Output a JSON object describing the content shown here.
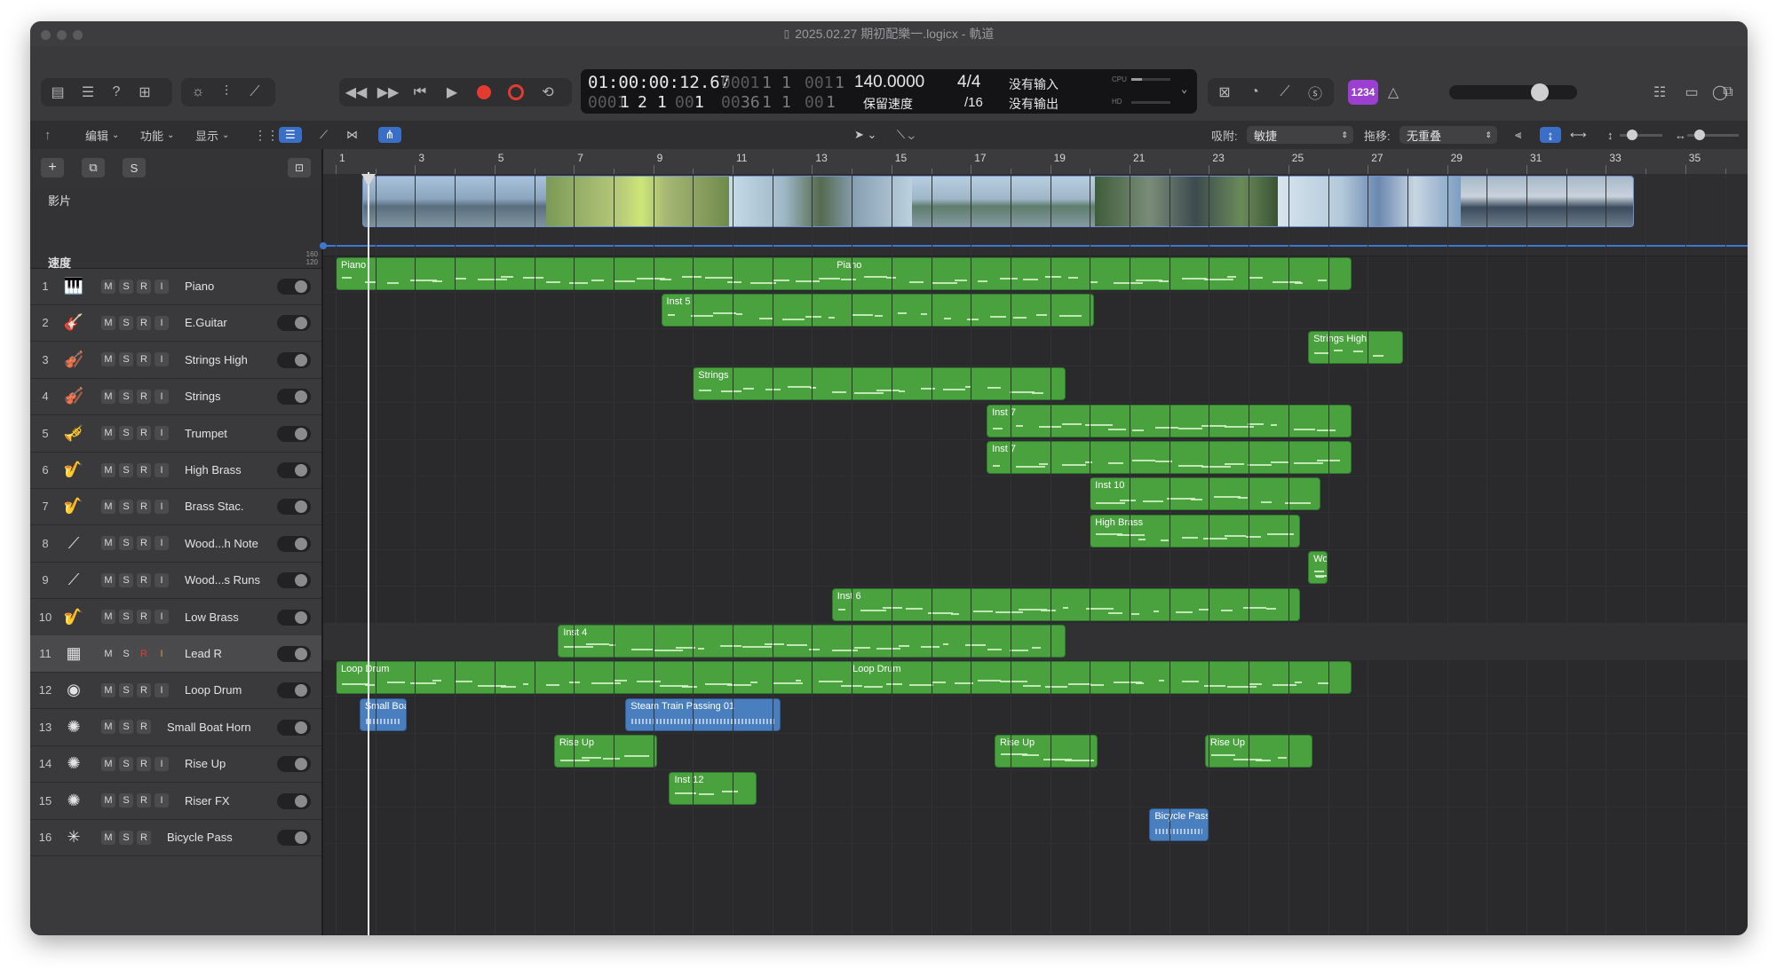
{
  "window": {
    "title": "2025.02.27 期初配樂一.logicx - 軌道"
  },
  "toolbar": {
    "lcd": {
      "smpte": "01:00:00:12.67",
      "pos_bar_dim": "0001",
      "pos_beat": "1",
      "pos_div": "1",
      "pos_tick_dim": "001",
      "pos_tick": "1",
      "line2_bar_dim": "0001",
      "line2_bar": "1",
      "line2_beat": "2",
      "line2_div": "1",
      "line2_tick_dim": "001",
      "line2_tick": "1",
      "line2_bar2_dim": "00",
      "line2_bar2": "36",
      "line2_beat2": "1",
      "line2_div2": "1",
      "line2_tick2_dim": "00",
      "line2_tick2": "1",
      "tempo": "140.0000",
      "tempo_mode": "保留速度",
      "signature": "4/4",
      "division": "/16",
      "input": "没有输入",
      "output": "没有输出",
      "cpu_label": "CPU",
      "hd_label": "HD"
    },
    "key_badge": "1234",
    "colors": {
      "record": "#e23b30",
      "lcd_bg": "#141416",
      "key_badge": "#9b3fd0"
    }
  },
  "subbar": {
    "edit": "编辑",
    "function": "功能",
    "view": "显示",
    "snap_label": "吸附:",
    "snap_value": "敏捷",
    "drag_label": "拖移:",
    "drag_value": "无重叠"
  },
  "header": {
    "movie_label": "影片",
    "tempo_label": "速度",
    "tempo_high": "160",
    "tempo_low": "120",
    "solo": "S"
  },
  "ruler": [
    "1",
    "3",
    "5",
    "7",
    "9",
    "11",
    "13",
    "15",
    "17",
    "19",
    "21",
    "23",
    "25",
    "27",
    "29",
    "31",
    "33",
    "35"
  ],
  "tracks": [
    {
      "num": "1",
      "name": "Piano",
      "icon": "piano-icon",
      "r": true,
      "i": true
    },
    {
      "num": "2",
      "name": "E.Guitar",
      "icon": "guitar-icon",
      "r": true,
      "i": true
    },
    {
      "num": "3",
      "name": "Strings High",
      "icon": "strings-icon",
      "r": true,
      "i": true
    },
    {
      "num": "4",
      "name": "Strings",
      "icon": "strings-icon",
      "r": true,
      "i": true
    },
    {
      "num": "5",
      "name": "Trumpet",
      "icon": "trumpet-icon",
      "r": true,
      "i": true
    },
    {
      "num": "6",
      "name": "High Brass",
      "icon": "brass-icon",
      "r": true,
      "i": true
    },
    {
      "num": "7",
      "name": "Brass Stac.",
      "icon": "brass-icon",
      "r": true,
      "i": true
    },
    {
      "num": "8",
      "name": "Wood...h Note",
      "icon": "woodwind-icon",
      "r": true,
      "i": true
    },
    {
      "num": "9",
      "name": "Wood...s Runs",
      "icon": "woodwind-icon",
      "r": true,
      "i": true
    },
    {
      "num": "10",
      "name": "Low Brass",
      "icon": "brass-icon",
      "r": true,
      "i": true
    },
    {
      "num": "11",
      "name": "Lead R",
      "icon": "synth-icon",
      "r": true,
      "i": true
    },
    {
      "num": "12",
      "name": "Loop Drum",
      "icon": "drum-icon",
      "r": true,
      "i": true
    },
    {
      "num": "13",
      "name": "Small Boat Horn",
      "icon": "sparkle-icon",
      "r": true,
      "i": false
    },
    {
      "num": "14",
      "name": "Rise Up",
      "icon": "sparkle-icon",
      "r": true,
      "i": true
    },
    {
      "num": "15",
      "name": "Riser FX",
      "icon": "sparkle-icon",
      "r": true,
      "i": true
    },
    {
      "num": "16",
      "name": "Bicycle Pass",
      "icon": "burst-icon",
      "r": true,
      "i": false
    }
  ],
  "regions": [
    {
      "track": 0,
      "name": "Piano",
      "name2": "Piano",
      "type": "midi"
    },
    {
      "track": 1,
      "name": "Inst 5",
      "type": "midi"
    },
    {
      "track": 2,
      "name": "Strings High",
      "type": "midi"
    },
    {
      "track": 3,
      "name": "Strings",
      "type": "midi"
    },
    {
      "track": 4,
      "name": "Inst 7",
      "type": "midi"
    },
    {
      "track": 5,
      "name": "Inst 7",
      "type": "midi"
    },
    {
      "track": 6,
      "name": "Inst 10",
      "type": "midi"
    },
    {
      "track": 7,
      "name": "High Brass",
      "type": "midi"
    },
    {
      "track": 8,
      "name": "Wood",
      "type": "midi"
    },
    {
      "track": 9,
      "name": "Inst 6",
      "type": "midi"
    },
    {
      "track": 10,
      "name": "Inst 4",
      "type": "midi"
    },
    {
      "track": 11,
      "name": "Loop Drum",
      "name2": "Loop Drum",
      "type": "midi"
    },
    {
      "track": 12,
      "name": "Small Boat",
      "type": "audio"
    },
    {
      "track": 12,
      "name": "Steam Train Passing 01",
      "type": "audio"
    },
    {
      "track": 13,
      "name": "Rise Up",
      "type": "midi"
    },
    {
      "track": 13,
      "name": "Rise Up",
      "type": "midi"
    },
    {
      "track": 13,
      "name": "Rise Up",
      "type": "midi"
    },
    {
      "track": 14,
      "name": "Inst 12",
      "type": "midi"
    },
    {
      "track": 15,
      "name": "Bicycle Pass",
      "type": "audio"
    }
  ]
}
